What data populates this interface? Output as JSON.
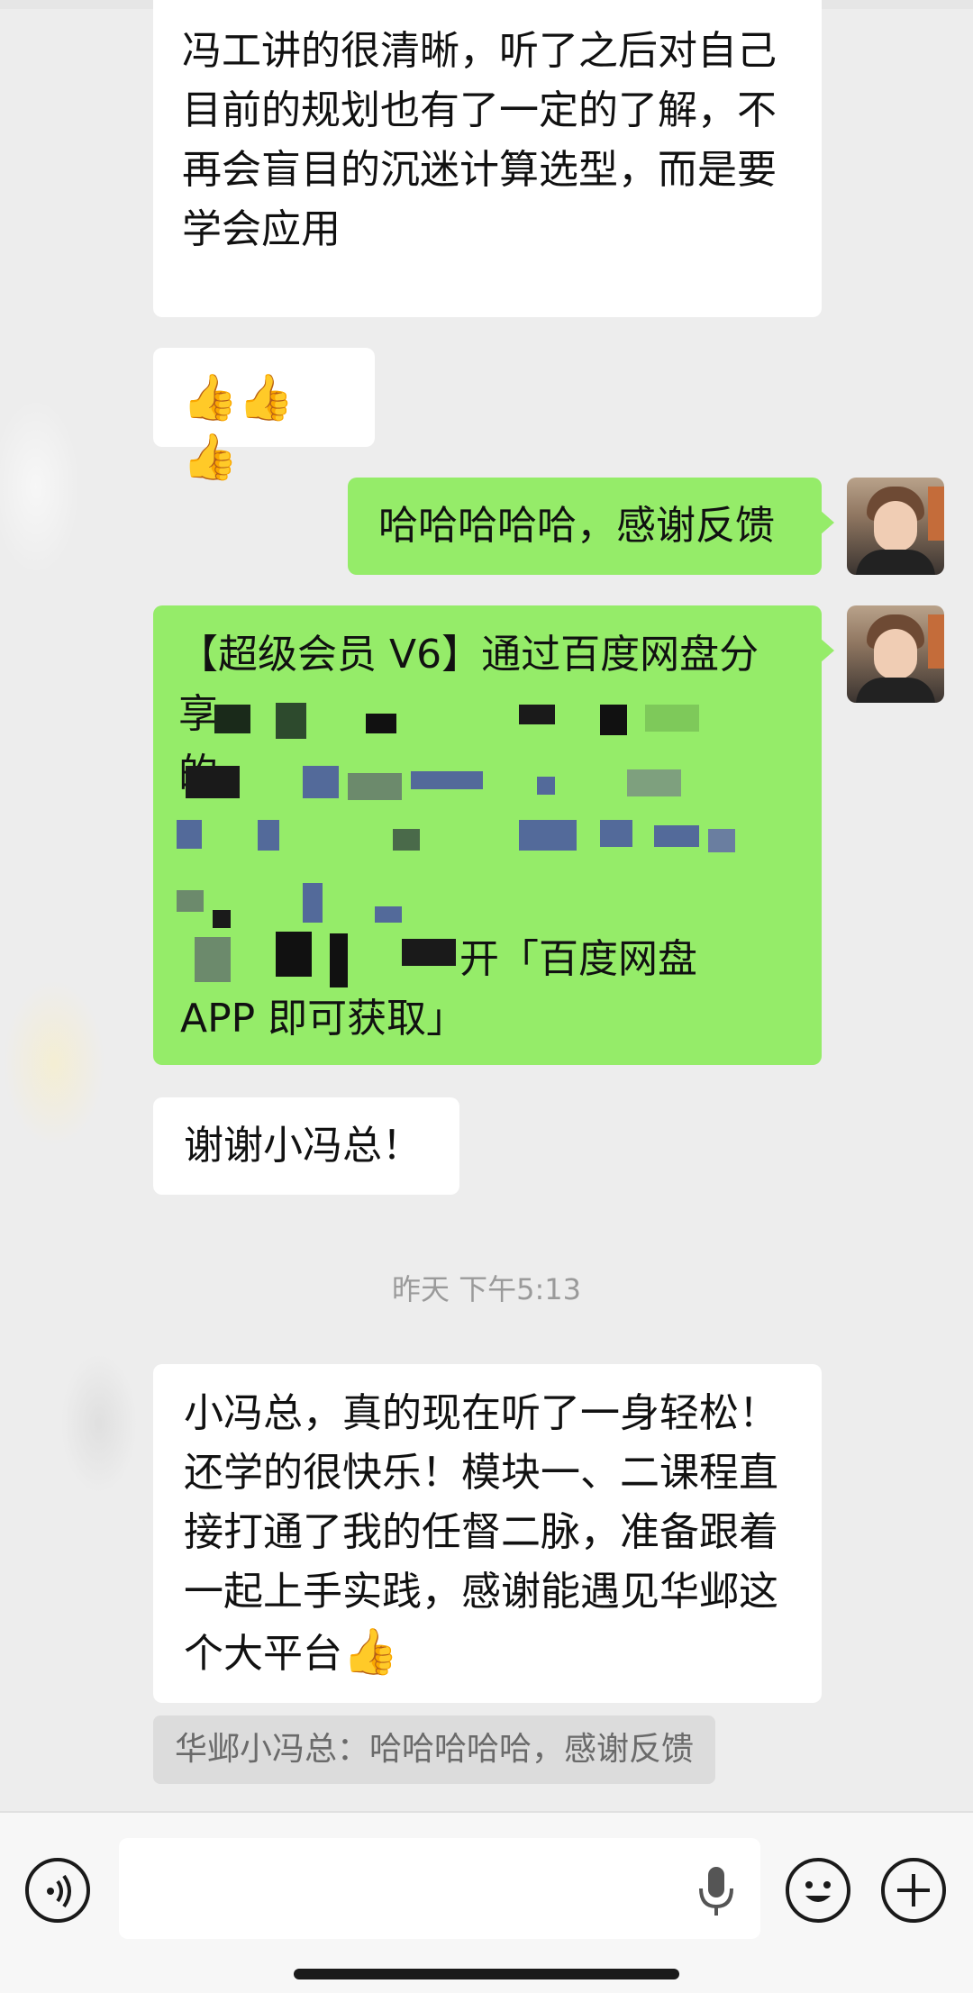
{
  "messages": {
    "m1_text": "冯工讲的很清晰，听了之后对自己目前的规划也有了一定的了解，不再会盲目的沉迷计算选型，而是要学会应用",
    "m2_thumbs": "👍👍👍",
    "m3_text": "哈哈哈哈哈，感谢反馈",
    "m4_line1": "【超级会员 V6】通过百度网盘分享",
    "m4_line2": "的",
    "m4_tail": "开「百度网盘",
    "m4_last": "APP 即可获取」",
    "m5_text": "谢谢小冯总！",
    "timestamp": "昨天 下午5:13",
    "m6_text": "小冯总，真的现在听了一身轻松！还学的很快乐！模块一、二课程直接打通了我的任督二脉，准备跟着一起上手实践，感谢能遇见华邺这个大平台",
    "m6_thumb": "👍",
    "quote_text": "华邺小冯总：哈哈哈哈哈，感谢反馈"
  },
  "input": {
    "placeholder": ""
  },
  "icons": {
    "voice": "voice-icon",
    "mic": "microphone-icon",
    "emoji": "emoji-icon",
    "plus": "plus-icon"
  },
  "colors": {
    "background": "#ededed",
    "bubble_white": "#ffffff",
    "bubble_green": "#95ec69",
    "timestamp": "#9a9a9a"
  }
}
